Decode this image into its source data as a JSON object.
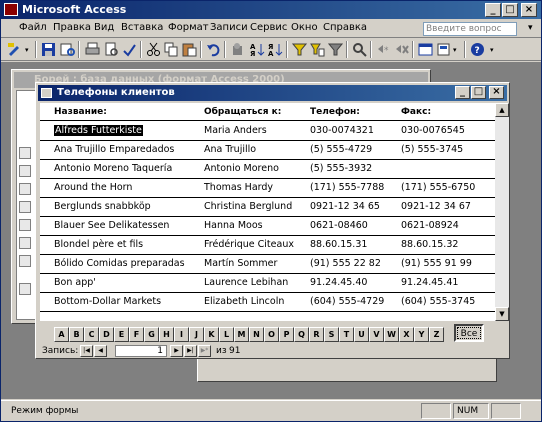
{
  "app": {
    "title": "Microsoft Access"
  },
  "menu": {
    "items": [
      "Файл",
      "Правка",
      "Вид",
      "Вставка",
      "Формат",
      "Записи",
      "Сервис",
      "Окно",
      "Справка"
    ],
    "help_placeholder": "Введите вопрос"
  },
  "db_window": {
    "title": "Борей : база данных (формат Access 2000)"
  },
  "form": {
    "title": "Телефоны клиентов",
    "headers": [
      "Название:",
      "Обращаться к:",
      "Телефон:",
      "Факс:"
    ],
    "rows": [
      [
        "Alfreds Futterkiste",
        "Maria Anders",
        "030-0074321",
        "030-0076545"
      ],
      [
        "Ana Trujillo Emparedados",
        "Ana Trujillo",
        "(5) 555-4729",
        "(5) 555-3745"
      ],
      [
        "Antonio Moreno Taquería",
        "Antonio Moreno",
        "(5) 555-3932",
        ""
      ],
      [
        "Around the Horn",
        "Thomas Hardy",
        "(171) 555-7788",
        "(171) 555-6750"
      ],
      [
        "Berglunds snabbköp",
        "Christina Berglund",
        "0921-12 34 65",
        "0921-12 34 67"
      ],
      [
        "Blauer See Delikatessen",
        "Hanna Moos",
        "0621-08460",
        "0621-08924"
      ],
      [
        "Blondel père et fils",
        "Frédérique Citeaux",
        "88.60.15.31",
        "88.60.15.32"
      ],
      [
        "Bólido Comidas preparadas",
        "Martín Sommer",
        "(91) 555 22 82",
        "(91) 555 91 99"
      ],
      [
        "Bon app'",
        "Laurence Lebihan",
        "91.24.45.40",
        "91.24.45.41"
      ],
      [
        "Bottom-Dollar Markets",
        "Elizabeth Lincoln",
        "(604) 555-4729",
        "(604) 555-3745"
      ]
    ],
    "letters": [
      "A",
      "B",
      "C",
      "D",
      "E",
      "F",
      "G",
      "H",
      "I",
      "J",
      "K",
      "L",
      "M",
      "N",
      "O",
      "P",
      "Q",
      "R",
      "S",
      "T",
      "U",
      "V",
      "W",
      "X",
      "Y",
      "Z"
    ],
    "all_label": "Все",
    "nav": {
      "label": "Запись:",
      "current": "1",
      "of_label": "из",
      "total": "91"
    }
  },
  "status": {
    "mode": "Режим формы",
    "num": "NUM"
  }
}
